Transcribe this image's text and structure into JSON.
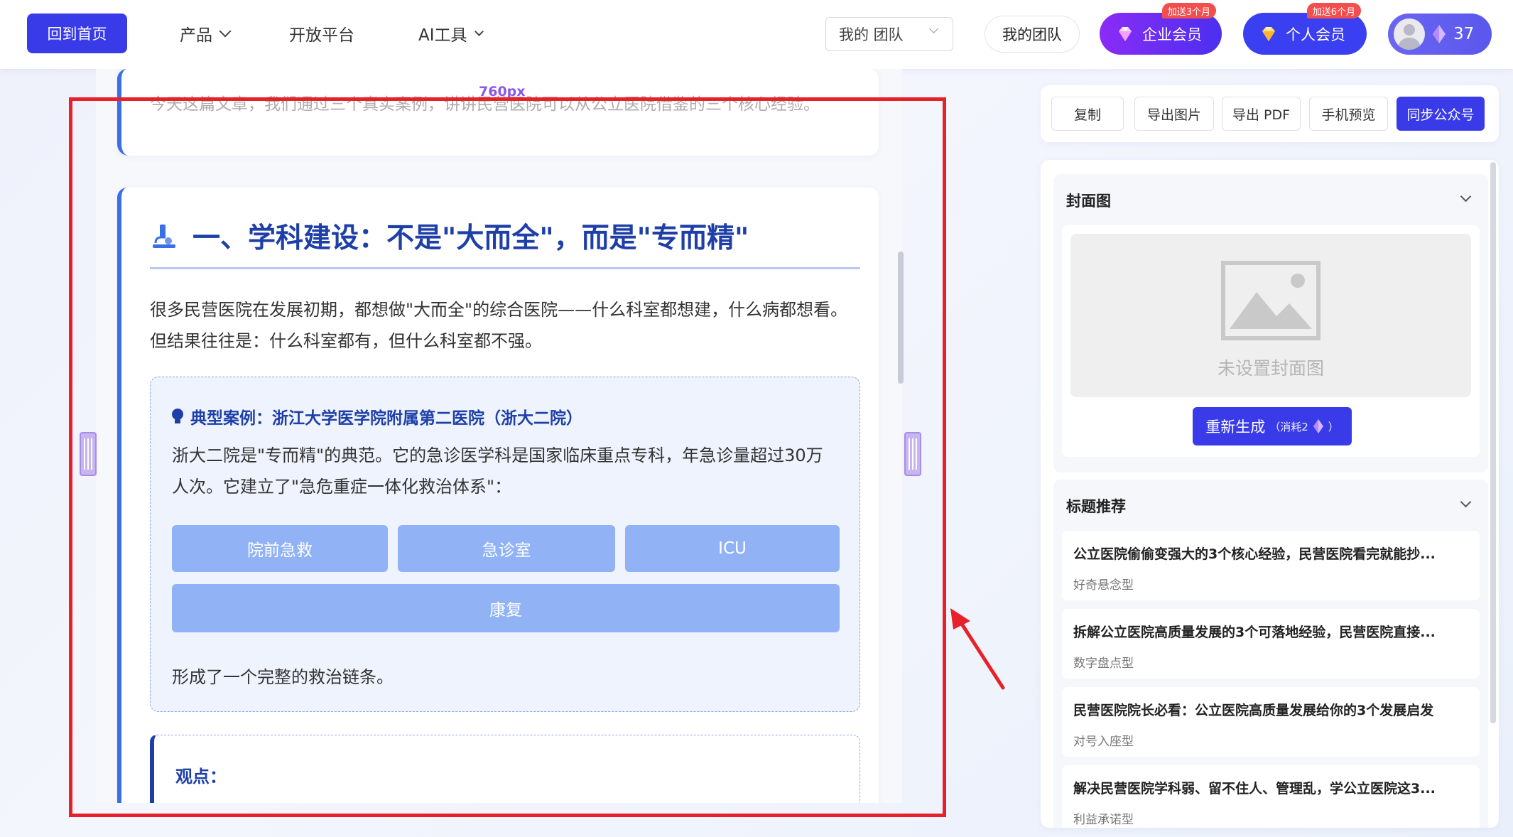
{
  "header": {
    "home_label": "回到首页",
    "nav": [
      {
        "label": "产品"
      },
      {
        "label": "开放平台"
      },
      {
        "label": "AI工具"
      }
    ],
    "team_select_value": "我的 团队",
    "team_button": "我的团队",
    "enterprise_member": {
      "label": "企业会员",
      "promo": "加送3个月"
    },
    "personal_member": {
      "label": "个人会员",
      "promo": "加送6个月"
    },
    "credits": "37"
  },
  "preview": {
    "width_label": "760px",
    "prev_text": "今天这篇文章，我们通过三个真实案例，讲讲民营医院可以从公立医院借鉴的三个核心经验。",
    "section_title": "一、学科建设：不是\"大而全\"，而是\"专而精\"",
    "paragraph": "很多民营医院在发展初期，都想做\"大而全\"的综合医院——什么科室都想建，什么病都想看。但结果往往是：什么科室都有，但什么科室都不强。",
    "case": {
      "title": "典型案例：浙江大学医学院附属第二医院（浙大二院）",
      "text": "浙大二院是\"专而精\"的典范。它的急诊医学科是国家临床重点专科，年急诊量超过30万人次。它建立了\"急危重症一体化救治体系\"：",
      "chips": [
        "院前急救",
        "急诊室",
        "ICU",
        "康复"
      ],
      "footer": "形成了一个完整的救治链条。"
    },
    "view_title": "观点："
  },
  "toolbar": {
    "buttons": [
      "复制",
      "导出图片",
      "导出 PDF",
      "手机预览",
      "同步公众号"
    ]
  },
  "cover": {
    "heading": "封面图",
    "empty_text": "未设置封面图",
    "regen_label": "重新生成",
    "regen_cost": "（消耗2",
    "regen_cost_end": "）"
  },
  "titles": {
    "heading": "标题推荐",
    "items": [
      {
        "title": "公立医院偷偷变强大的3个核心经验，民营医院看完就能抄...",
        "style": "好奇悬念型"
      },
      {
        "title": "拆解公立医院高质量发展的3个可落地经验，民营医院直接...",
        "style": "数字盘点型"
      },
      {
        "title": "民营医院院长必看：公立医院高质量发展给你的3个发展启发",
        "style": "对号入座型"
      },
      {
        "title": "解决民营医院学科弱、留不住人、管理乱，学公立医院这3...",
        "style": "利益承诺型"
      }
    ]
  },
  "colors": {
    "primary": "#3a3be8",
    "accent_blue": "#1e3fa8",
    "chip": "#91b3f6",
    "highlight_red": "#e8202a"
  }
}
